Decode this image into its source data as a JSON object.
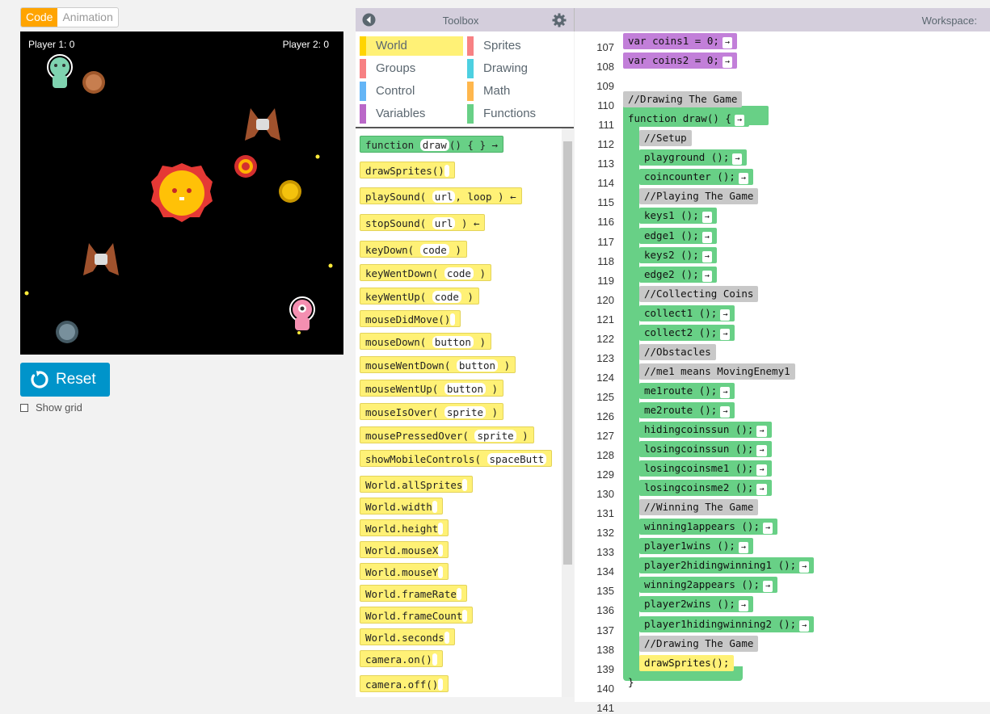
{
  "mode_tabs": {
    "code": "Code",
    "animation": "Animation"
  },
  "game": {
    "player1": "Player 1:  0",
    "player2": "Player 2:  0"
  },
  "reset_label": "Reset",
  "show_grid_label": "Show grid",
  "toolbox": {
    "title": "Toolbox"
  },
  "workspace": {
    "title": "Workspace:"
  },
  "categories": [
    {
      "label": "World",
      "color": "#ffd400"
    },
    {
      "label": "Sprites",
      "color": "#f78183"
    },
    {
      "label": "Groups",
      "color": "#f78183"
    },
    {
      "label": "Drawing",
      "color": "#4dd0e1"
    },
    {
      "label": "Control",
      "color": "#64b5f6"
    },
    {
      "label": "Math",
      "color": "#ffb74d"
    },
    {
      "label": "Variables",
      "color": "#ba68c8"
    },
    {
      "label": "Functions",
      "color": "#68d086"
    }
  ],
  "palette": [
    {
      "pre": "function ",
      "arg": "draw",
      "post": "() { } →",
      "color": "green"
    },
    {
      "pre": "drawSprites()",
      "arg": "",
      "post": "",
      "color": "yellow"
    },
    {
      "pre": "playSound( ",
      "arg": "url",
      "post": ", loop ) ←",
      "color": "yellow"
    },
    {
      "pre": "stopSound( ",
      "arg": "url",
      "post": " ) ←",
      "color": "yellow"
    },
    {
      "pre": "keyDown( ",
      "arg": "code",
      "post": " )",
      "color": "yellow"
    },
    {
      "pre": "keyWentDown( ",
      "arg": "code",
      "post": " )",
      "color": "yellow"
    },
    {
      "pre": "keyWentUp( ",
      "arg": "code",
      "post": " )",
      "color": "yellow"
    },
    {
      "pre": "mouseDidMove()",
      "arg": "",
      "post": "",
      "color": "yellow"
    },
    {
      "pre": "mouseDown( ",
      "arg": "button",
      "post": " )",
      "color": "yellow"
    },
    {
      "pre": "mouseWentDown( ",
      "arg": "button",
      "post": " )",
      "color": "yellow"
    },
    {
      "pre": "mouseWentUp( ",
      "arg": "button",
      "post": " )",
      "color": "yellow"
    },
    {
      "pre": "mouseIsOver( ",
      "arg": "sprite",
      "post": " )",
      "color": "yellow"
    },
    {
      "pre": "mousePressedOver( ",
      "arg": "sprite",
      "post": " )",
      "color": "yellow"
    },
    {
      "pre": "showMobileControls( ",
      "arg": "spaceButt",
      "post": "",
      "color": "yellow"
    },
    {
      "pre": "World.allSprites",
      "arg": "",
      "post": "",
      "color": "yellow"
    },
    {
      "pre": "World.width",
      "arg": "",
      "post": "",
      "color": "yellow"
    },
    {
      "pre": "World.height",
      "arg": "",
      "post": "",
      "color": "yellow"
    },
    {
      "pre": "World.mouseX",
      "arg": "",
      "post": "",
      "color": "yellow"
    },
    {
      "pre": "World.mouseY",
      "arg": "",
      "post": "",
      "color": "yellow"
    },
    {
      "pre": "World.frameRate",
      "arg": "",
      "post": "",
      "color": "yellow"
    },
    {
      "pre": "World.frameCount",
      "arg": "",
      "post": "",
      "color": "yellow"
    },
    {
      "pre": "World.seconds",
      "arg": "",
      "post": "",
      "color": "yellow"
    },
    {
      "pre": "camera.on()",
      "arg": "",
      "post": "",
      "color": "yellow"
    },
    {
      "pre": "camera.off()",
      "arg": "",
      "post": "",
      "color": "yellow"
    }
  ],
  "code_lines": [
    {
      "n": "107",
      "text": "var coins1 = 0;",
      "kind": "purple"
    },
    {
      "n": "108",
      "text": "var coins2 = 0;",
      "kind": "purple"
    },
    {
      "n": "109",
      "text": "",
      "kind": "empty"
    },
    {
      "n": "110",
      "text": "//Drawing The Game",
      "kind": "gray"
    },
    {
      "n": "111",
      "text": "function draw() {",
      "kind": "func"
    },
    {
      "n": "112",
      "text": "//Setup",
      "kind": "gray"
    },
    {
      "n": "113",
      "text": "playground ();",
      "kind": "green"
    },
    {
      "n": "114",
      "text": "coincounter ();",
      "kind": "green"
    },
    {
      "n": "115",
      "text": "//Playing The Game",
      "kind": "gray"
    },
    {
      "n": "116",
      "text": "keys1 ();",
      "kind": "green"
    },
    {
      "n": "117",
      "text": "edge1 ();",
      "kind": "green"
    },
    {
      "n": "118",
      "text": "keys2 ();",
      "kind": "green"
    },
    {
      "n": "119",
      "text": "edge2 ();",
      "kind": "green"
    },
    {
      "n": "120",
      "text": "//Collecting Coins",
      "kind": "gray"
    },
    {
      "n": "121",
      "text": "collect1 ();",
      "kind": "green"
    },
    {
      "n": "122",
      "text": "collect2 ();",
      "kind": "green"
    },
    {
      "n": "123",
      "text": "//Obstacles",
      "kind": "gray"
    },
    {
      "n": "124",
      "text": "//me1 means MovingEnemy1",
      "kind": "gray"
    },
    {
      "n": "125",
      "text": "me1route ();",
      "kind": "green"
    },
    {
      "n": "126",
      "text": "me2route ();",
      "kind": "green"
    },
    {
      "n": "127",
      "text": "hidingcoinssun ();",
      "kind": "green"
    },
    {
      "n": "128",
      "text": "losingcoinssun ();",
      "kind": "green"
    },
    {
      "n": "129",
      "text": "losingcoinsme1 ();",
      "kind": "green"
    },
    {
      "n": "130",
      "text": "losingcoinsme2 ();",
      "kind": "green"
    },
    {
      "n": "131",
      "text": "//Winning The Game",
      "kind": "gray"
    },
    {
      "n": "132",
      "text": "winning1appears ();",
      "kind": "green"
    },
    {
      "n": "133",
      "text": "player1wins ();",
      "kind": "green"
    },
    {
      "n": "134",
      "text": "player2hidingwinning1 ();",
      "kind": "green"
    },
    {
      "n": "135",
      "text": "winning2appears ();",
      "kind": "green"
    },
    {
      "n": "136",
      "text": "player2wins ();",
      "kind": "green"
    },
    {
      "n": "137",
      "text": "player1hidingwinning2 ();",
      "kind": "green"
    },
    {
      "n": "138",
      "text": "//Drawing The Game",
      "kind": "gray"
    },
    {
      "n": "139",
      "text": "drawSprites();",
      "kind": "yellow"
    },
    {
      "n": "140",
      "text": "}",
      "kind": "end"
    },
    {
      "n": "141",
      "text": "",
      "kind": "empty"
    }
  ]
}
